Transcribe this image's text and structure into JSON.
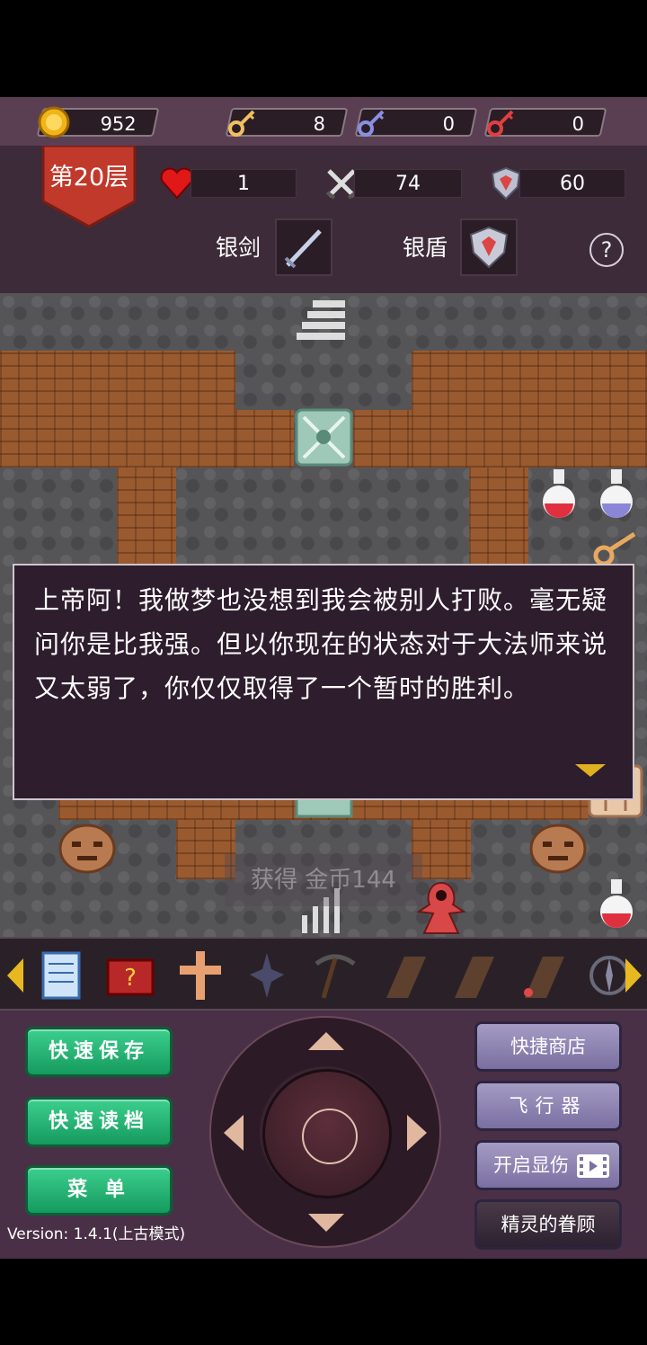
{
  "resources": {
    "gold": "952",
    "yellow_keys": "8",
    "blue_keys": "0",
    "red_keys": "0"
  },
  "floor": {
    "label": "第20层"
  },
  "stats": {
    "hp": "1",
    "attack": "74",
    "defense": "60"
  },
  "equipment": {
    "weapon_label": "银剑",
    "armor_label": "银盾",
    "help_icon": "?"
  },
  "dialog": {
    "text": "上帝阿！我做梦也没想到我会被别人打败。毫无疑问你是比我强。但以你现在的状态对于大法师来说又太弱了，你仅仅取得了一个暂时的胜利。"
  },
  "toast": {
    "text": "获得 金币144"
  },
  "items": [
    "notebook-icon",
    "monster-book-icon",
    "holy-cross-icon",
    "dark-amulet-icon",
    "pickaxe-icon",
    "flying-wand-up-icon",
    "flying-wand-down-icon",
    "flying-wand-icon",
    "compass-icon"
  ],
  "buttons": {
    "quick_save": "快速保存",
    "quick_load": "快速读档",
    "menu": "菜 单",
    "quick_shop": "快捷商店",
    "flyer": "飞行器",
    "show_damage": "开启显伤",
    "fairy_favor": "精灵的眷顾"
  },
  "version": "Version: 1.4.1(上古模式)",
  "colors": {
    "top_bar": "#5a3f52",
    "stat_panel": "#3d2b39",
    "dialog_bg": "#2e1d2d",
    "green_button": "#22b070",
    "purple_button": "#8e84b2",
    "floor_badge": "#c0392b"
  }
}
